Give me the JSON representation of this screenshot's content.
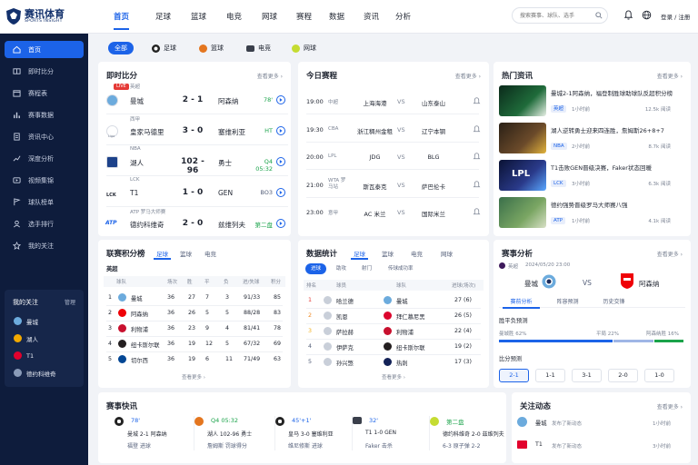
{
  "brand": {
    "name": "赛讯体育",
    "sub": "SPORTS INSIGHT"
  },
  "sidebar": {
    "items": [
      {
        "label": "首页",
        "icon": "home-icon"
      },
      {
        "label": "即时比分",
        "icon": "scoreboard-icon"
      },
      {
        "label": "赛程表",
        "icon": "calendar-icon"
      },
      {
        "label": "赛事数据",
        "icon": "bar-chart-icon"
      },
      {
        "label": "资讯中心",
        "icon": "document-icon"
      },
      {
        "label": "深度分析",
        "icon": "trend-icon"
      },
      {
        "label": "视频集锦",
        "icon": "video-icon"
      },
      {
        "label": "球队榜单",
        "icon": "flag-icon"
      },
      {
        "label": "选手排行",
        "icon": "user-icon"
      },
      {
        "label": "我的关注",
        "icon": "star-icon"
      }
    ],
    "follow": {
      "title": "我的关注",
      "manage": "管理",
      "items": [
        "曼城",
        "湖人",
        "T1",
        "德约科维奇"
      ]
    }
  },
  "topnav": {
    "items": [
      "首页",
      "足球",
      "篮球",
      "电竞",
      "网球",
      "赛程",
      "数据",
      "资讯",
      "分析"
    ],
    "search_placeholder": "搜索赛事、球队、选手",
    "login": "登录 / 注册"
  },
  "chips": [
    "全部",
    "足球",
    "篮球",
    "电竞",
    "网球"
  ],
  "live": {
    "title": "即时比分",
    "more": "查看更多 ›",
    "live_badge": "LIVE",
    "matches": [
      {
        "league": "英超",
        "home": "曼城",
        "score": "2 - 1",
        "away": "阿森纳",
        "status": "78'"
      },
      {
        "league": "西甲",
        "home": "皇家马德里",
        "score": "3 - 0",
        "away": "塞维利亚",
        "status": "HT"
      },
      {
        "league": "NBA",
        "home": "湖人",
        "score": "102 - 96",
        "away": "勇士",
        "status": "Q4 05:32"
      },
      {
        "league": "LCK",
        "home": "T1",
        "score": "1 - 0",
        "away": "GEN",
        "status": "BO3"
      },
      {
        "league": "ATP 罗马大师赛",
        "home": "德约科维奇",
        "score": "2 - 0",
        "away": "兹维列夫",
        "status": "第二盘"
      }
    ],
    "logos": {
      "lck": "LCK",
      "atp": "ATP",
      "laliga": "Liga"
    }
  },
  "schedule": {
    "title": "今日赛程",
    "more": "查看更多 ›",
    "items": [
      {
        "time": "19:00",
        "league": "中超",
        "home": "上海海港",
        "vs": "VS",
        "away": "山东泰山"
      },
      {
        "time": "19:30",
        "league": "CBA",
        "home": "浙江稠州金租",
        "vs": "VS",
        "away": "辽宁本钢"
      },
      {
        "time": "20:00",
        "league": "LPL",
        "home": "JDG",
        "vs": "VS",
        "away": "BLG"
      },
      {
        "time": "21:00",
        "league": "WTA 罗马站",
        "home": "斯瓦泰克",
        "vs": "VS",
        "away": "萨巴伦卡"
      },
      {
        "time": "23:00",
        "league": "意甲",
        "home": "AC 米兰",
        "vs": "VS",
        "away": "国际米兰"
      }
    ]
  },
  "news": {
    "title": "热门资讯",
    "more": "查看更多 ›",
    "items": [
      {
        "title": "曼城2-1阿森纳，福登制胜球助球队反超积分榜",
        "tag": "英超",
        "ago": "1小时前",
        "views": "12.5k 阅读"
      },
      {
        "title": "湖人逆转勇士迎来四连胜，詹姆斯26+8+7",
        "tag": "NBA",
        "ago": "2小时前",
        "views": "8.7k 阅读"
      },
      {
        "title": "T1击败GEN晋级决赛，Faker状态回暖",
        "tag": "LCK",
        "ago": "3小时前",
        "views": "6.3k 阅读"
      },
      {
        "title": "德约强势晋级罗马大师赛八强",
        "tag": "ATP",
        "ago": "1小时前",
        "views": "4.1k 阅读"
      }
    ],
    "img_labels": {
      "lpl": "LPL"
    }
  },
  "standings": {
    "title": "联赛积分榜",
    "tabs": [
      "足球",
      "篮球",
      "电竞"
    ],
    "league": "英超",
    "headers": [
      "球队",
      "场次",
      "胜",
      "平",
      "负",
      "进/失球",
      "积分"
    ],
    "rows": [
      {
        "rank": "1",
        "team": "曼城",
        "played": "36",
        "w": "27",
        "d": "7",
        "l": "3",
        "gd": "91/33",
        "pts": "85"
      },
      {
        "rank": "2",
        "team": "阿森纳",
        "played": "36",
        "w": "26",
        "d": "5",
        "l": "5",
        "gd": "88/28",
        "pts": "83"
      },
      {
        "rank": "3",
        "team": "利物浦",
        "played": "36",
        "w": "23",
        "d": "9",
        "l": "4",
        "gd": "81/41",
        "pts": "78"
      },
      {
        "rank": "4",
        "team": "纽卡斯尔联",
        "played": "36",
        "w": "19",
        "d": "12",
        "l": "5",
        "gd": "67/32",
        "pts": "69"
      },
      {
        "rank": "5",
        "team": "切尔西",
        "played": "36",
        "w": "19",
        "d": "6",
        "l": "11",
        "gd": "71/49",
        "pts": "63"
      }
    ],
    "more": "查看更多 ›"
  },
  "stats": {
    "title": "数据统计",
    "tabs": [
      "足球",
      "篮球",
      "电竞",
      "网球"
    ],
    "pills": [
      "进球",
      "助攻",
      "射门",
      "传球成功率"
    ],
    "headers": [
      "排名",
      "球员",
      "球队",
      "进球(场次)"
    ],
    "rows": [
      {
        "rank": "1",
        "player": "哈兰德",
        "team": "曼城",
        "val": "27 (6)"
      },
      {
        "rank": "2",
        "player": "凯恩",
        "team": "拜仁慕尼黑",
        "val": "26 (5)"
      },
      {
        "rank": "3",
        "player": "萨拉赫",
        "team": "利物浦",
        "val": "22 (4)"
      },
      {
        "rank": "4",
        "player": "伊萨克",
        "team": "纽卡斯尔联",
        "val": "19 (2)"
      },
      {
        "rank": "5",
        "player": "孙兴慜",
        "team": "热刺",
        "val": "17 (3)"
      }
    ],
    "more": "查看更多 ›"
  },
  "analysis": {
    "title": "赛事分析",
    "more": "查看更多 ›",
    "league": "英超",
    "datetime": "2024/05/20 23:00",
    "home": "曼城",
    "vs": "VS",
    "away": "阿森纳",
    "tabs": [
      "赛前分析",
      "阵容预测",
      "历史交锋"
    ],
    "wdl_title": "胜平负预测",
    "home_label": "曼城胜 62%",
    "draw_label": "平局 22%",
    "away_label": "阿森纳胜 16%",
    "home_pct": 62,
    "draw_pct": 22,
    "away_pct": 16,
    "score_title": "比分预测",
    "scores": [
      "2-1",
      "1-1",
      "3-1",
      "2-0",
      "1-0"
    ]
  },
  "flash": {
    "title": "赛事快讯",
    "items": [
      {
        "status": "78'",
        "l1": "曼城 2-1 阿森纳",
        "l2": "福登 进球"
      },
      {
        "status": "Q4 05:32",
        "l1": "湖人 102-96 勇士",
        "l2": "詹姆斯 罚球得分"
      },
      {
        "status": "45'+1'",
        "l1": "皇马 3-0 塞维利亚",
        "l2": "维尼修斯 进球"
      },
      {
        "status": "32'",
        "l1": "T1 1-0 GEN",
        "l2": "Faker 击杀"
      },
      {
        "status": "第二盘",
        "l1": "德约科维奇 2-0 兹维列夫",
        "l2": "6-3 原子弹 2-2"
      }
    ]
  },
  "follow_updates": {
    "title": "关注动态",
    "more": "查看更多 ›",
    "items": [
      {
        "team": "曼城",
        "text": "发布了新动态",
        "ago": "1小时前"
      },
      {
        "team": "T1",
        "text": "发布了新动态",
        "ago": "3小时前"
      }
    ]
  },
  "colors": {
    "accent": "#1c63e8",
    "sidebar": "#0e1c3c",
    "live": "#e53935",
    "status": "#1aa34a"
  }
}
